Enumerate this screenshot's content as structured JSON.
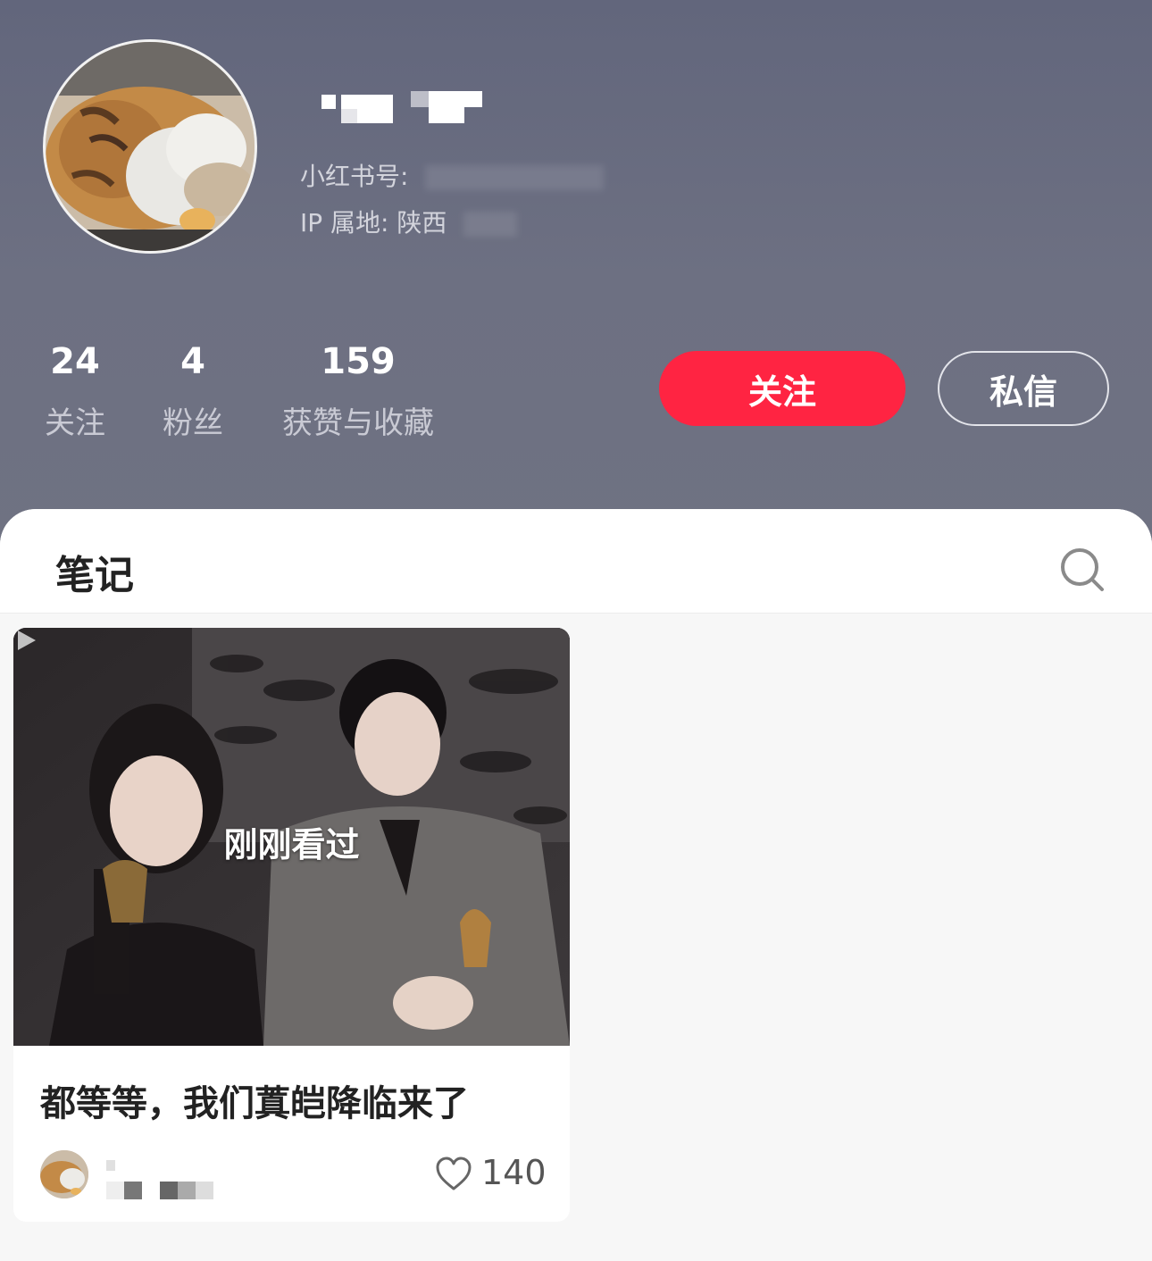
{
  "profile": {
    "red_id_label": "小红书号:",
    "ip_label": "IP 属地: 陕西",
    "stats": [
      {
        "value": "24",
        "label": "关注"
      },
      {
        "value": "4",
        "label": "粉丝"
      },
      {
        "value": "159",
        "label": "获赞与收藏"
      }
    ],
    "follow_button": "关注",
    "message_button": "私信",
    "follow_color": "#ff2442"
  },
  "notes": {
    "tab_title": "笔记",
    "search_icon": "search-icon",
    "items": [
      {
        "overlay_text": "刚刚看过",
        "title": "都等等，我们蒖皑降临来了",
        "likes": "140",
        "media_icon": "play-icon",
        "like_icon": "heart-outline-icon"
      }
    ]
  }
}
